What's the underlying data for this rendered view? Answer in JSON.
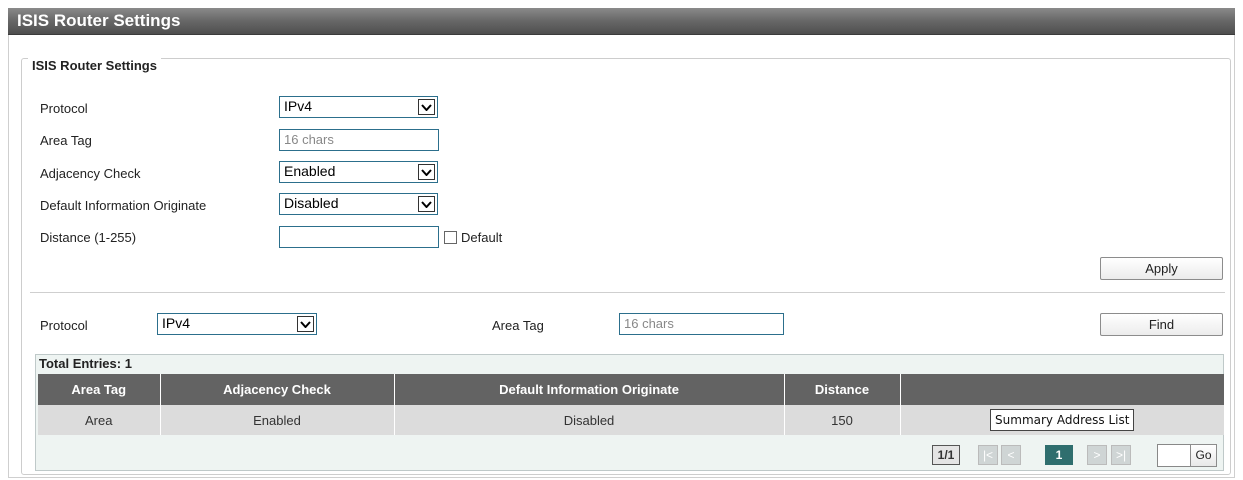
{
  "page": {
    "title": "ISIS Router Settings"
  },
  "settings": {
    "legend": "ISIS Router Settings",
    "protocol": {
      "label": "Protocol",
      "value": "IPv4"
    },
    "area_tag": {
      "label": "Area Tag",
      "placeholder": "16 chars"
    },
    "adjacency_check": {
      "label": "Adjacency Check",
      "value": "Enabled"
    },
    "default_info": {
      "label": "Default Information Originate",
      "value": "Disabled"
    },
    "distance": {
      "label": "Distance (1-255)",
      "value": "",
      "default_label": "Default",
      "default_checked": false
    },
    "apply_label": "Apply"
  },
  "search": {
    "protocol": {
      "label": "Protocol",
      "value": "IPv4"
    },
    "area_tag": {
      "label": "Area Tag",
      "placeholder": "16 chars"
    },
    "find_label": "Find"
  },
  "table": {
    "total_entries": "Total Entries: 1",
    "headers": [
      "Area Tag",
      "Adjacency Check",
      "Default Information Originate",
      "Distance",
      ""
    ],
    "rows": [
      {
        "area_tag": "Area",
        "adjacency": "Enabled",
        "default_info": "Disabled",
        "distance": "150",
        "action": "Summary Address List"
      }
    ]
  },
  "pager": {
    "page_info": "1/1",
    "first": "|<",
    "prev": "<",
    "current": "1",
    "next": ">",
    "last": ">|",
    "go_label": "Go"
  },
  "icons": {
    "dropdown": "chevron-down-icon"
  },
  "colors": {
    "title_bar": "#5e5e5e",
    "table_header": "#636363",
    "table_row": "#dcdcdc",
    "current_page": "#2f6e6e",
    "input_border": "#2c6f8c"
  }
}
